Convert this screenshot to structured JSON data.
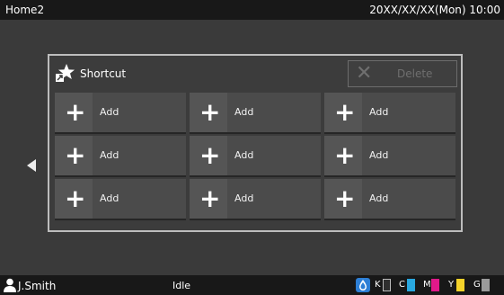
{
  "header": {
    "title": "Home2",
    "datetime": "20XX/XX/XX(Mon) 10:00"
  },
  "panel": {
    "title": "Shortcut",
    "delete_label": "Delete",
    "slots": [
      {
        "label": "Add"
      },
      {
        "label": "Add"
      },
      {
        "label": "Add"
      },
      {
        "label": "Add"
      },
      {
        "label": "Add"
      },
      {
        "label": "Add"
      },
      {
        "label": "Add"
      },
      {
        "label": "Add"
      },
      {
        "label": "Add"
      }
    ]
  },
  "status": {
    "user": "J.Smith",
    "state": "Idle",
    "inks": [
      {
        "letter": "K",
        "color": "#2f2f2f",
        "level": 0.0
      },
      {
        "letter": "C",
        "color": "#29a8e0",
        "level": 1.0
      },
      {
        "letter": "M",
        "color": "#e0198a",
        "level": 1.0
      },
      {
        "letter": "Y",
        "color": "#f4d22a",
        "level": 1.0
      },
      {
        "letter": "G",
        "color": "#9a9a9a",
        "level": 1.0
      }
    ]
  },
  "colors": {
    "background": "#3a3a3a",
    "bar": "#181818",
    "tile": "#4b4b4b"
  }
}
